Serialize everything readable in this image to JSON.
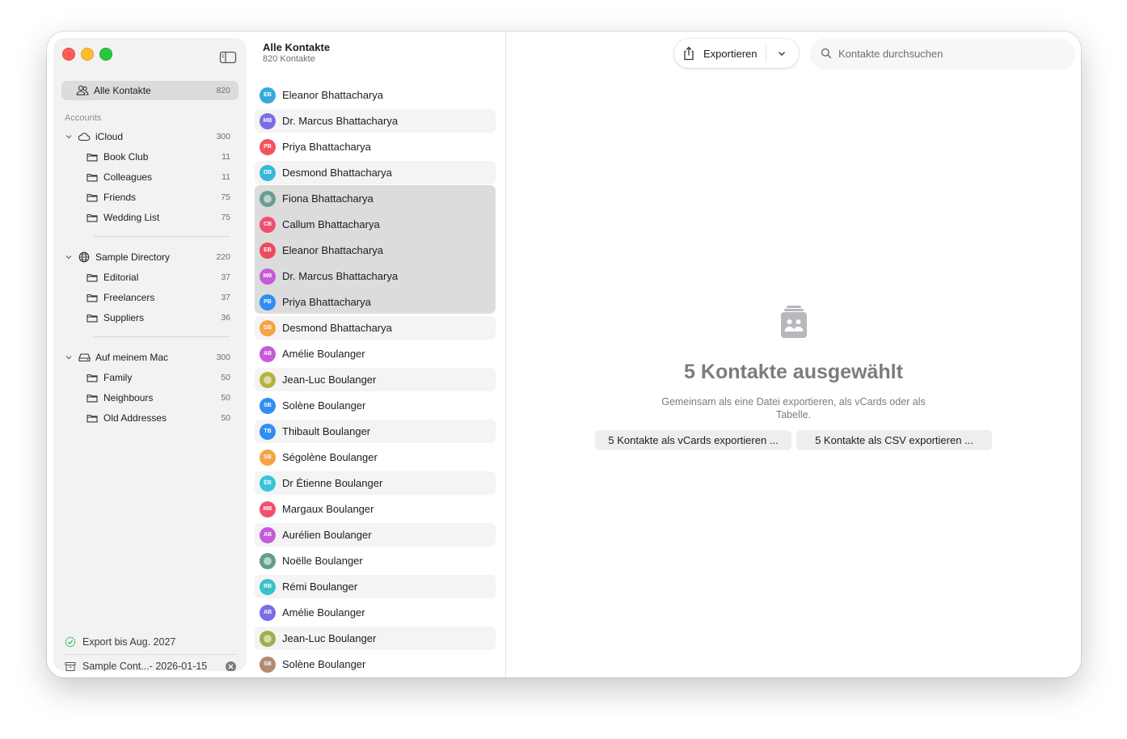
{
  "sidebar": {
    "all": {
      "label": "Alle Kontakte",
      "count": "820"
    },
    "accounts_header": "Accounts",
    "groups": [
      {
        "label": "iCloud",
        "count": "300",
        "icon": "cloud-icon",
        "items": [
          {
            "label": "Book Club",
            "count": "11"
          },
          {
            "label": "Colleagues",
            "count": "11"
          },
          {
            "label": "Friends",
            "count": "75"
          },
          {
            "label": "Wedding List",
            "count": "75"
          }
        ]
      },
      {
        "label": "Sample Directory",
        "count": "220",
        "icon": "globe-icon",
        "items": [
          {
            "label": "Editorial",
            "count": "37"
          },
          {
            "label": "Freelancers",
            "count": "37"
          },
          {
            "label": "Suppliers",
            "count": "36"
          }
        ]
      },
      {
        "label": "Auf meinem Mac",
        "count": "300",
        "icon": "drive-icon",
        "items": [
          {
            "label": "Family",
            "count": "50"
          },
          {
            "label": "Neighbours",
            "count": "50"
          },
          {
            "label": "Old Addresses",
            "count": "50"
          }
        ]
      }
    ],
    "footer": {
      "export_status": "Export bis Aug. 2027",
      "archive_label": "Sample Cont...- 2026-01-15"
    }
  },
  "list": {
    "title": "Alle Kontakte",
    "count": "820 Kontakte",
    "contacts": [
      {
        "name": "Eleanor Bhattacharya",
        "initials": "EB",
        "color": "#34aadc",
        "photo": false,
        "state": "none"
      },
      {
        "name": "Dr. Marcus Bhattacharya",
        "initials": "MB",
        "color": "#7a6ee6",
        "photo": false,
        "state": "alt"
      },
      {
        "name": "Priya Bhattacharya",
        "initials": "PB",
        "color": "#f2545b",
        "photo": false,
        "state": "none"
      },
      {
        "name": "Desmond Bhattacharya",
        "initials": "DB",
        "color": "#38b8d9",
        "photo": false,
        "state": "alt"
      },
      {
        "name": "Fiona Bhattacharya",
        "initials": "",
        "color": "#6a9c93",
        "photo": true,
        "state": "selected"
      },
      {
        "name": "Callum Bhattacharya",
        "initials": "CB",
        "color": "#f0506e",
        "photo": false,
        "state": "selected"
      },
      {
        "name": "Eleanor Bhattacharya",
        "initials": "EB",
        "color": "#ee4a5f",
        "photo": false,
        "state": "selected"
      },
      {
        "name": "Dr. Marcus Bhattacharya",
        "initials": "MB",
        "color": "#c65ad8",
        "photo": false,
        "state": "selected"
      },
      {
        "name": "Priya Bhattacharya",
        "initials": "PB",
        "color": "#2f8ef2",
        "photo": false,
        "state": "selected"
      },
      {
        "name": "Desmond Bhattacharya",
        "initials": "DB",
        "color": "#f5a444",
        "photo": false,
        "state": "alt"
      },
      {
        "name": "Amélie Boulanger",
        "initials": "AB",
        "color": "#c65ad8",
        "photo": false,
        "state": "none"
      },
      {
        "name": "Jean-Luc Boulanger",
        "initials": "",
        "color": "#b5b240",
        "photo": true,
        "state": "alt"
      },
      {
        "name": "Solène Boulanger",
        "initials": "SB",
        "color": "#2f8ef2",
        "photo": false,
        "state": "none"
      },
      {
        "name": "Thibault Boulanger",
        "initials": "TB",
        "color": "#2f8ef2",
        "photo": false,
        "state": "alt"
      },
      {
        "name": "Ségolène Boulanger",
        "initials": "SB",
        "color": "#f5a444",
        "photo": false,
        "state": "none"
      },
      {
        "name": "Dr Étienne Boulanger",
        "initials": "ÉB",
        "color": "#38c3d9",
        "photo": false,
        "state": "alt"
      },
      {
        "name": "Margaux Boulanger",
        "initials": "MB",
        "color": "#f0506e",
        "photo": false,
        "state": "none"
      },
      {
        "name": "Aurélien Boulanger",
        "initials": "AB",
        "color": "#c65ad8",
        "photo": false,
        "state": "alt"
      },
      {
        "name": "Noëlle Boulanger",
        "initials": "",
        "color": "#5f9d8f",
        "photo": true,
        "state": "none"
      },
      {
        "name": "Rémi Boulanger",
        "initials": "RB",
        "color": "#38c3c8",
        "photo": false,
        "state": "alt"
      },
      {
        "name": "Amélie Boulanger",
        "initials": "AB",
        "color": "#7a6ee6",
        "photo": false,
        "state": "none"
      },
      {
        "name": "Jean-Luc Boulanger",
        "initials": "",
        "color": "#9fae48",
        "photo": true,
        "state": "alt"
      },
      {
        "name": "Solène Boulanger",
        "initials": "SB",
        "color": "#b08a70",
        "photo": false,
        "state": "none"
      }
    ]
  },
  "toolbar": {
    "export_label": "Exportieren",
    "search_placeholder": "Kontakte durchsuchen"
  },
  "detail": {
    "title": "5 Kontakte ausgewählt",
    "description": "Gemeinsam als eine Datei exportieren, als vCards oder als Tabelle.",
    "vcard_button": "5 Kontakte als vCards exportieren ...",
    "csv_button": "5 Kontakte als CSV exportieren ..."
  }
}
